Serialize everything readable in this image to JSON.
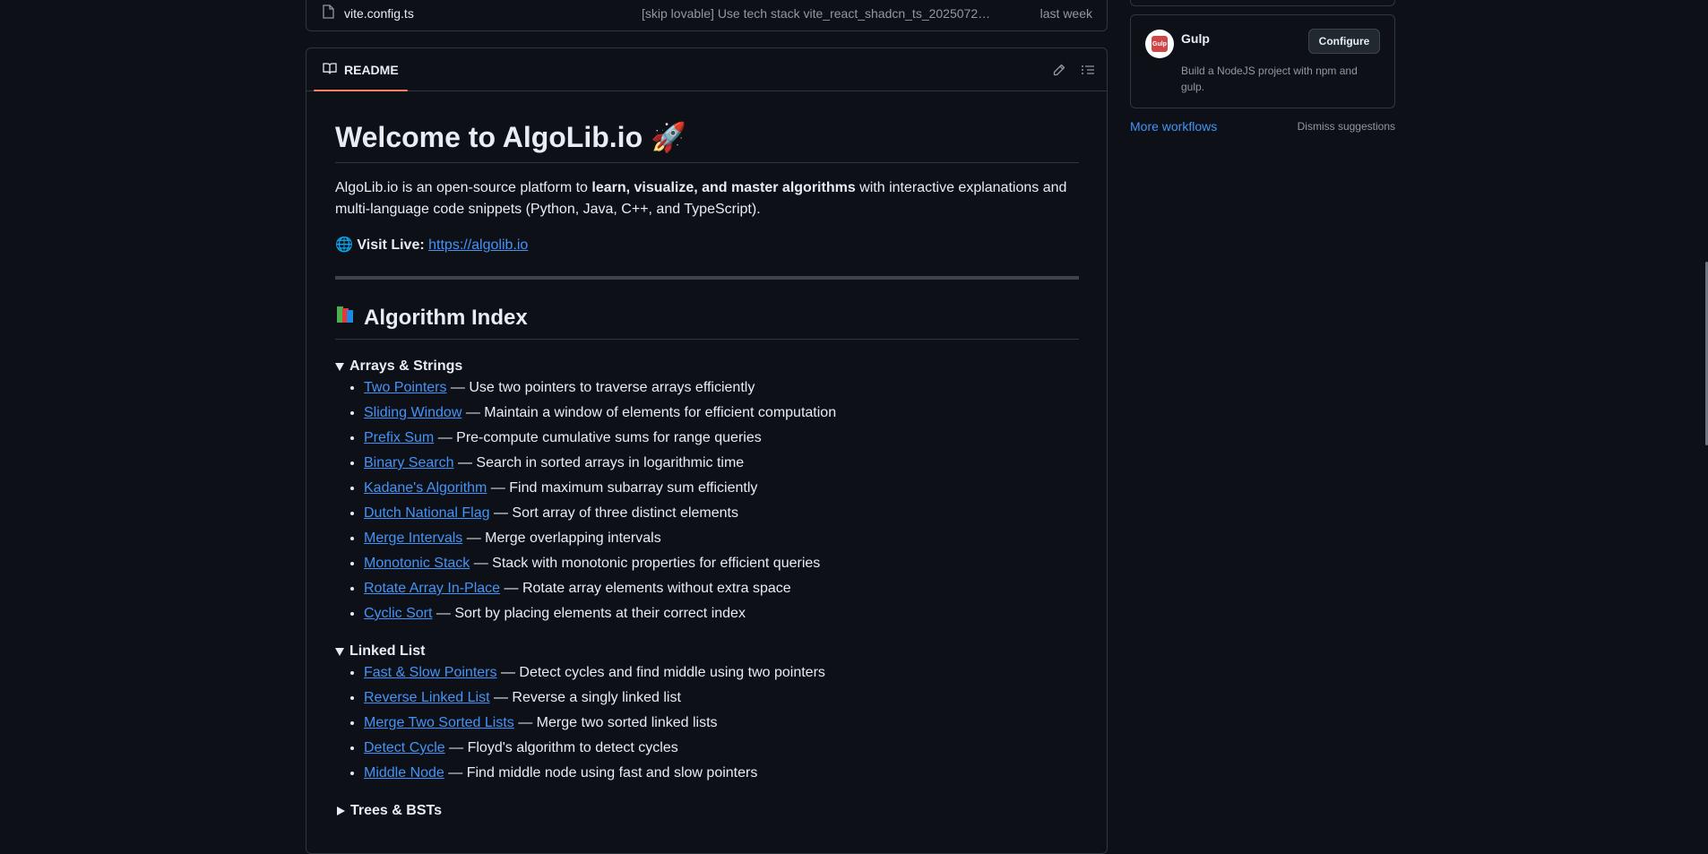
{
  "file_row": {
    "name": "vite.config.ts",
    "message": "[skip lovable] Use tech stack vite_react_shadcn_ts_20250728_...",
    "time": "last week"
  },
  "readme": {
    "tab_label": "README",
    "title": "Welcome to AlgoLib.io 🚀",
    "intro_prefix": "AlgoLib.io is an open-source platform to ",
    "intro_bold": "learn, visualize, and master algorithms",
    "intro_suffix": " with interactive explanations and multi-language code snippets (Python, Java, C++, and TypeScript).",
    "visit_emoji": "🌐",
    "visit_label": "Visit Live:",
    "visit_url": "https://algolib.io",
    "index_title": "Algorithm Index",
    "sections": [
      {
        "title": "Arrays & Strings",
        "items": [
          {
            "link": "Two Pointers",
            "desc": " — Use two pointers to traverse arrays efficiently"
          },
          {
            "link": "Sliding Window",
            "desc": " — Maintain a window of elements for efficient computation"
          },
          {
            "link": "Prefix Sum",
            "desc": " — Pre-compute cumulative sums for range queries"
          },
          {
            "link": "Binary Search",
            "desc": " — Search in sorted arrays in logarithmic time"
          },
          {
            "link": "Kadane's Algorithm",
            "desc": " — Find maximum subarray sum efficiently"
          },
          {
            "link": "Dutch National Flag",
            "desc": " — Sort array of three distinct elements"
          },
          {
            "link": "Merge Intervals",
            "desc": " — Merge overlapping intervals"
          },
          {
            "link": "Monotonic Stack",
            "desc": " — Stack with monotonic properties for efficient queries"
          },
          {
            "link": "Rotate Array In-Place",
            "desc": " — Rotate array elements without extra space"
          },
          {
            "link": "Cyclic Sort",
            "desc": " — Sort by placing elements at their correct index"
          }
        ]
      },
      {
        "title": "Linked List",
        "items": [
          {
            "link": "Fast & Slow Pointers",
            "desc": " — Detect cycles and find middle using two pointers"
          },
          {
            "link": "Reverse Linked List",
            "desc": " — Reverse a singly linked list"
          },
          {
            "link": "Merge Two Sorted Lists",
            "desc": " — Merge two sorted linked lists"
          },
          {
            "link": "Detect Cycle",
            "desc": " — Floyd's algorithm to detect cycles"
          },
          {
            "link": "Middle Node",
            "desc": " — Find middle node using fast and slow pointers"
          }
        ]
      },
      {
        "title": "Trees & BSTs",
        "items": []
      }
    ]
  },
  "sidebar": {
    "workflow_name": "Gulp",
    "workflow_logo_text": "Gulp",
    "workflow_desc": "Build a NodeJS project with npm and gulp.",
    "configure_label": "Configure",
    "more_workflows": "More workflows",
    "dismiss": "Dismiss suggestions"
  },
  "colors": {
    "background": "#0d1117",
    "link": "#4493f8",
    "tab_underline": "#f78166",
    "gulp_red": "#cf4647"
  }
}
